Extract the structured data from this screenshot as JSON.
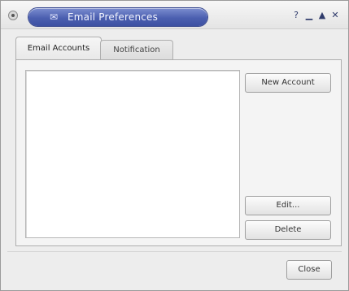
{
  "window": {
    "title": "Email Preferences",
    "title_icon": "app-icon",
    "controls": [
      "help-icon",
      "minimize-icon",
      "maximize-icon",
      "close-icon"
    ],
    "title_color": "#4b5fb0"
  },
  "tabs": [
    {
      "label": "Email Accounts",
      "active": true
    },
    {
      "label": "Notification",
      "active": false
    }
  ],
  "accounts": {
    "items": []
  },
  "buttons": {
    "new_account": "New Account",
    "edit": "Edit...",
    "delete": "Delete",
    "close": "Close"
  }
}
